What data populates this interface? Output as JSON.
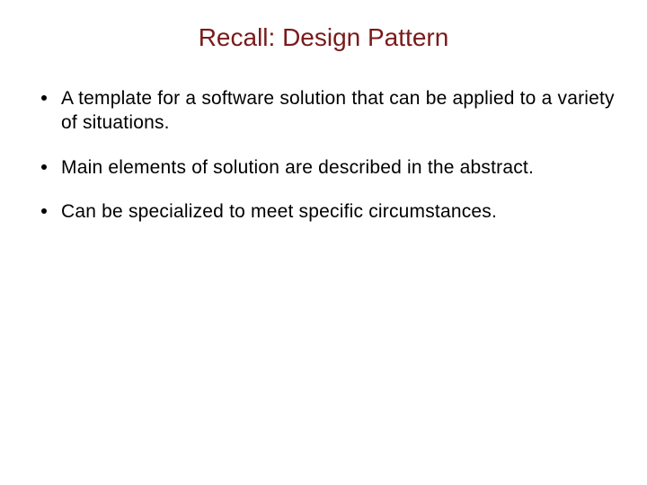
{
  "slide": {
    "title": "Recall:  Design Pattern",
    "bullets": [
      "A template for a software solution that can be applied to a variety of situations.",
      "Main elements of solution are described in the abstract.",
      "Can be specialized to meet specific circumstances."
    ]
  }
}
